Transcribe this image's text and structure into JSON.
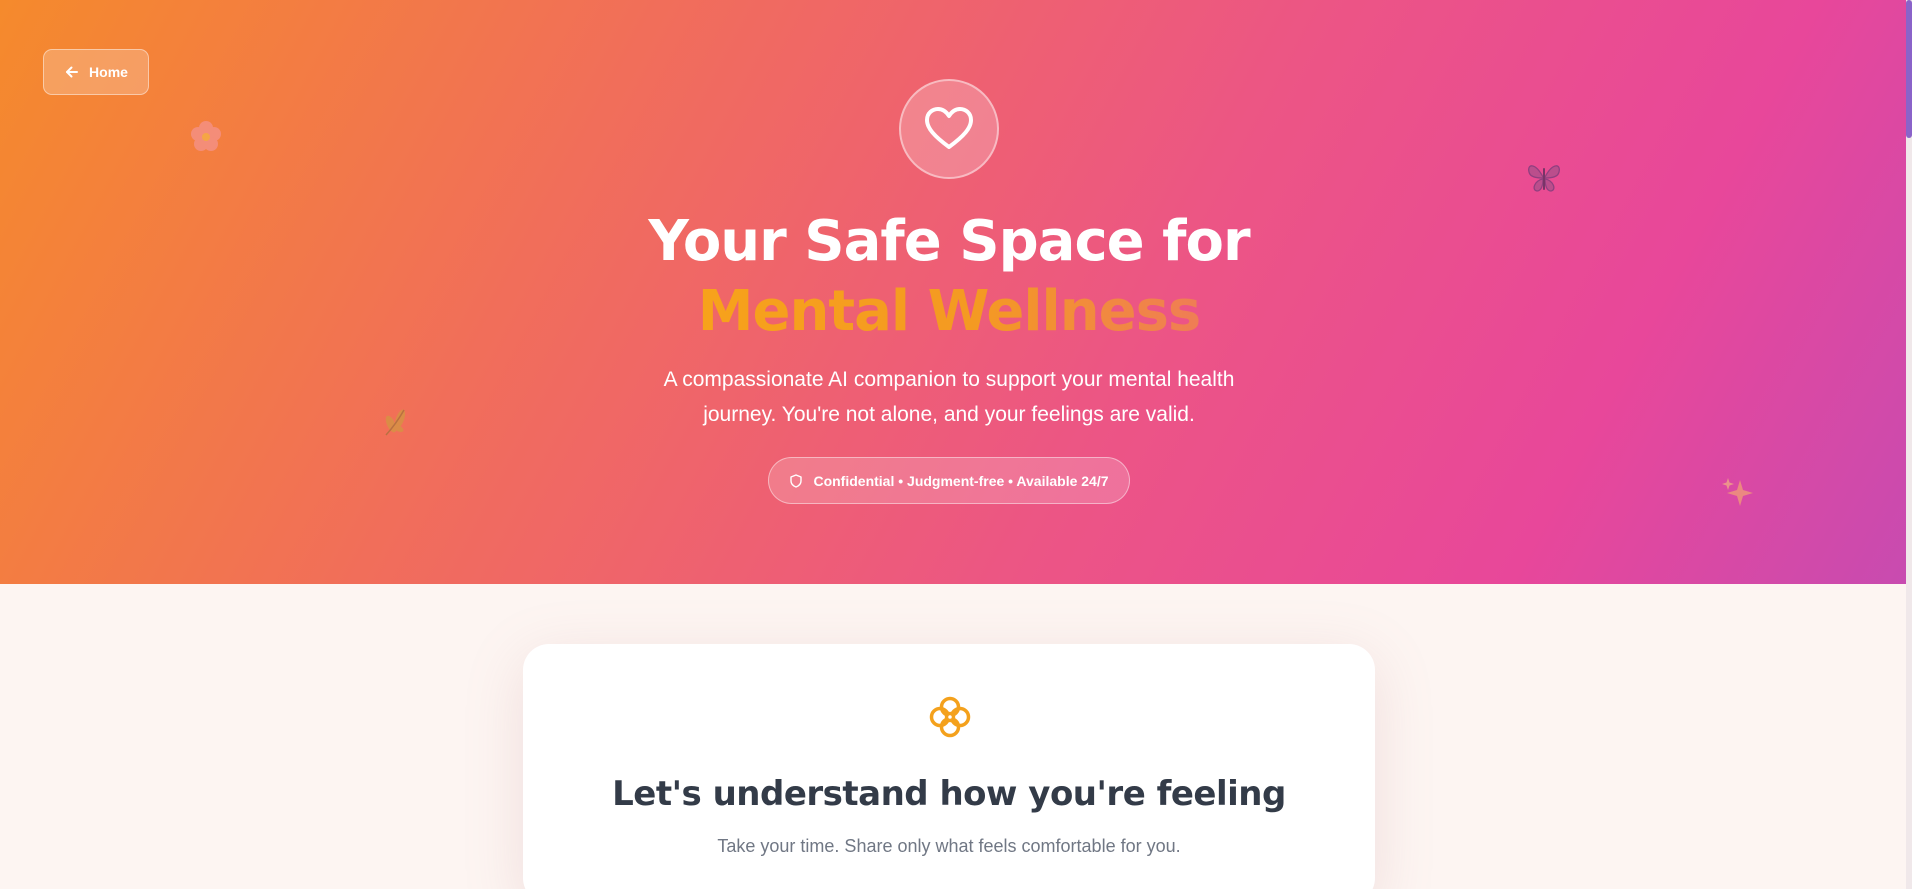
{
  "nav": {
    "home_label": "Home",
    "home_icon": "arrow-left-icon"
  },
  "hero": {
    "title_line1": "Your Safe Space for",
    "title_line2": "Mental Wellness",
    "subtitle": "A compassionate AI companion to support your mental health journey. You're not alone, and your feelings are valid.",
    "badge": "Confidential • Judgment-free • Available 24/7",
    "badge_icon": "shield-icon",
    "main_icon": "heart-icon",
    "decorations": [
      "flower-icon",
      "leaf-icon",
      "butterfly-icon",
      "sparkle-icon"
    ]
  },
  "card": {
    "icon": "flower-clover-icon",
    "title": "Let's understand how you're feeling",
    "subtitle": "Take your time. Share only what feels comfortable for you."
  },
  "colors": {
    "gradient_start": "#f58a2c",
    "gradient_mid": "#ec5585",
    "gradient_end": "#c84bb0",
    "accent": "#f7a21b",
    "card_title": "#333b48",
    "page_bg": "#fdf5f2"
  }
}
